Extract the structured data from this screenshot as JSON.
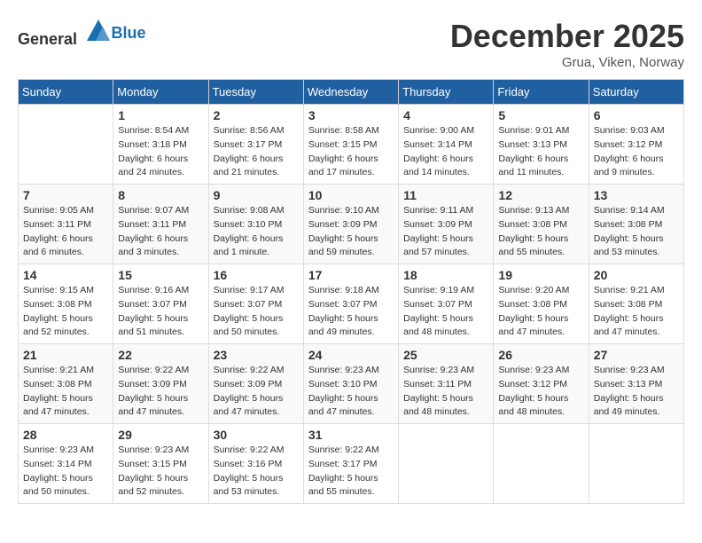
{
  "header": {
    "logo_general": "General",
    "logo_blue": "Blue",
    "month": "December 2025",
    "location": "Grua, Viken, Norway"
  },
  "weekdays": [
    "Sunday",
    "Monday",
    "Tuesday",
    "Wednesday",
    "Thursday",
    "Friday",
    "Saturday"
  ],
  "weeks": [
    [
      {
        "day": "",
        "info": ""
      },
      {
        "day": "1",
        "info": "Sunrise: 8:54 AM\nSunset: 3:18 PM\nDaylight: 6 hours\nand 24 minutes."
      },
      {
        "day": "2",
        "info": "Sunrise: 8:56 AM\nSunset: 3:17 PM\nDaylight: 6 hours\nand 21 minutes."
      },
      {
        "day": "3",
        "info": "Sunrise: 8:58 AM\nSunset: 3:15 PM\nDaylight: 6 hours\nand 17 minutes."
      },
      {
        "day": "4",
        "info": "Sunrise: 9:00 AM\nSunset: 3:14 PM\nDaylight: 6 hours\nand 14 minutes."
      },
      {
        "day": "5",
        "info": "Sunrise: 9:01 AM\nSunset: 3:13 PM\nDaylight: 6 hours\nand 11 minutes."
      },
      {
        "day": "6",
        "info": "Sunrise: 9:03 AM\nSunset: 3:12 PM\nDaylight: 6 hours\nand 9 minutes."
      }
    ],
    [
      {
        "day": "7",
        "info": "Sunrise: 9:05 AM\nSunset: 3:11 PM\nDaylight: 6 hours\nand 6 minutes."
      },
      {
        "day": "8",
        "info": "Sunrise: 9:07 AM\nSunset: 3:11 PM\nDaylight: 6 hours\nand 3 minutes."
      },
      {
        "day": "9",
        "info": "Sunrise: 9:08 AM\nSunset: 3:10 PM\nDaylight: 6 hours\nand 1 minute."
      },
      {
        "day": "10",
        "info": "Sunrise: 9:10 AM\nSunset: 3:09 PM\nDaylight: 5 hours\nand 59 minutes."
      },
      {
        "day": "11",
        "info": "Sunrise: 9:11 AM\nSunset: 3:09 PM\nDaylight: 5 hours\nand 57 minutes."
      },
      {
        "day": "12",
        "info": "Sunrise: 9:13 AM\nSunset: 3:08 PM\nDaylight: 5 hours\nand 55 minutes."
      },
      {
        "day": "13",
        "info": "Sunrise: 9:14 AM\nSunset: 3:08 PM\nDaylight: 5 hours\nand 53 minutes."
      }
    ],
    [
      {
        "day": "14",
        "info": "Sunrise: 9:15 AM\nSunset: 3:08 PM\nDaylight: 5 hours\nand 52 minutes."
      },
      {
        "day": "15",
        "info": "Sunrise: 9:16 AM\nSunset: 3:07 PM\nDaylight: 5 hours\nand 51 minutes."
      },
      {
        "day": "16",
        "info": "Sunrise: 9:17 AM\nSunset: 3:07 PM\nDaylight: 5 hours\nand 50 minutes."
      },
      {
        "day": "17",
        "info": "Sunrise: 9:18 AM\nSunset: 3:07 PM\nDaylight: 5 hours\nand 49 minutes."
      },
      {
        "day": "18",
        "info": "Sunrise: 9:19 AM\nSunset: 3:07 PM\nDaylight: 5 hours\nand 48 minutes."
      },
      {
        "day": "19",
        "info": "Sunrise: 9:20 AM\nSunset: 3:08 PM\nDaylight: 5 hours\nand 47 minutes."
      },
      {
        "day": "20",
        "info": "Sunrise: 9:21 AM\nSunset: 3:08 PM\nDaylight: 5 hours\nand 47 minutes."
      }
    ],
    [
      {
        "day": "21",
        "info": "Sunrise: 9:21 AM\nSunset: 3:08 PM\nDaylight: 5 hours\nand 47 minutes."
      },
      {
        "day": "22",
        "info": "Sunrise: 9:22 AM\nSunset: 3:09 PM\nDaylight: 5 hours\nand 47 minutes."
      },
      {
        "day": "23",
        "info": "Sunrise: 9:22 AM\nSunset: 3:09 PM\nDaylight: 5 hours\nand 47 minutes."
      },
      {
        "day": "24",
        "info": "Sunrise: 9:23 AM\nSunset: 3:10 PM\nDaylight: 5 hours\nand 47 minutes."
      },
      {
        "day": "25",
        "info": "Sunrise: 9:23 AM\nSunset: 3:11 PM\nDaylight: 5 hours\nand 48 minutes."
      },
      {
        "day": "26",
        "info": "Sunrise: 9:23 AM\nSunset: 3:12 PM\nDaylight: 5 hours\nand 48 minutes."
      },
      {
        "day": "27",
        "info": "Sunrise: 9:23 AM\nSunset: 3:13 PM\nDaylight: 5 hours\nand 49 minutes."
      }
    ],
    [
      {
        "day": "28",
        "info": "Sunrise: 9:23 AM\nSunset: 3:14 PM\nDaylight: 5 hours\nand 50 minutes."
      },
      {
        "day": "29",
        "info": "Sunrise: 9:23 AM\nSunset: 3:15 PM\nDaylight: 5 hours\nand 52 minutes."
      },
      {
        "day": "30",
        "info": "Sunrise: 9:22 AM\nSunset: 3:16 PM\nDaylight: 5 hours\nand 53 minutes."
      },
      {
        "day": "31",
        "info": "Sunrise: 9:22 AM\nSunset: 3:17 PM\nDaylight: 5 hours\nand 55 minutes."
      },
      {
        "day": "",
        "info": ""
      },
      {
        "day": "",
        "info": ""
      },
      {
        "day": "",
        "info": ""
      }
    ]
  ]
}
